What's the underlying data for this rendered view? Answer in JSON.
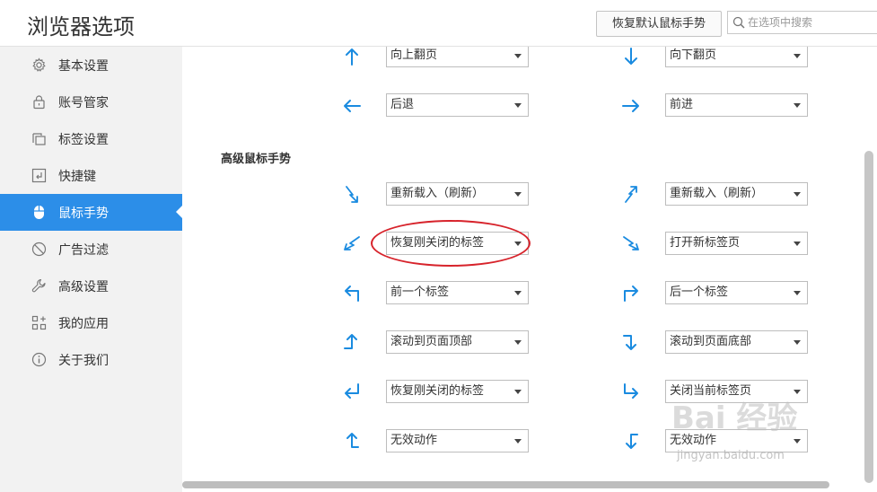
{
  "header": {
    "title": "浏览器选项",
    "reset_button": "恢复默认鼠标手势",
    "search_placeholder": "在选项中搜索"
  },
  "sidebar": {
    "items": [
      {
        "label": "基本设置",
        "icon": "gear-icon"
      },
      {
        "label": "账号管家",
        "icon": "lock-icon"
      },
      {
        "label": "标签设置",
        "icon": "tabs-icon"
      },
      {
        "label": "快捷键",
        "icon": "keyboard-icon"
      },
      {
        "label": "鼠标手势",
        "icon": "mouse-icon",
        "active": true
      },
      {
        "label": "广告过滤",
        "icon": "block-icon"
      },
      {
        "label": "高级设置",
        "icon": "wrench-icon"
      },
      {
        "label": "我的应用",
        "icon": "apps-icon"
      },
      {
        "label": "关于我们",
        "icon": "info-icon"
      }
    ]
  },
  "gestures": {
    "basic": [
      {
        "left": "向上翻页",
        "right": "向下翻页"
      },
      {
        "left": "后退",
        "right": "前进"
      }
    ],
    "advanced_heading": "高级鼠标手势",
    "advanced": [
      {
        "left": "重新载入（刷新）",
        "right": "重新载入（刷新）"
      },
      {
        "left": "恢复刚关闭的标签",
        "right": "打开新标签页"
      },
      {
        "left": "前一个标签",
        "right": "后一个标签"
      },
      {
        "left": "滚动到页面顶部",
        "right": "滚动到页面底部"
      },
      {
        "left": "恢复刚关闭的标签",
        "right": "关闭当前标签页"
      },
      {
        "left": "无效动作",
        "right": "无效动作"
      }
    ]
  },
  "watermark": {
    "text": "Bai 经验",
    "sub": "jingyan.baidu.com"
  },
  "colors": {
    "accent": "#2c8ee8",
    "arrow": "#1a8be0",
    "highlight": "#d7232b"
  }
}
